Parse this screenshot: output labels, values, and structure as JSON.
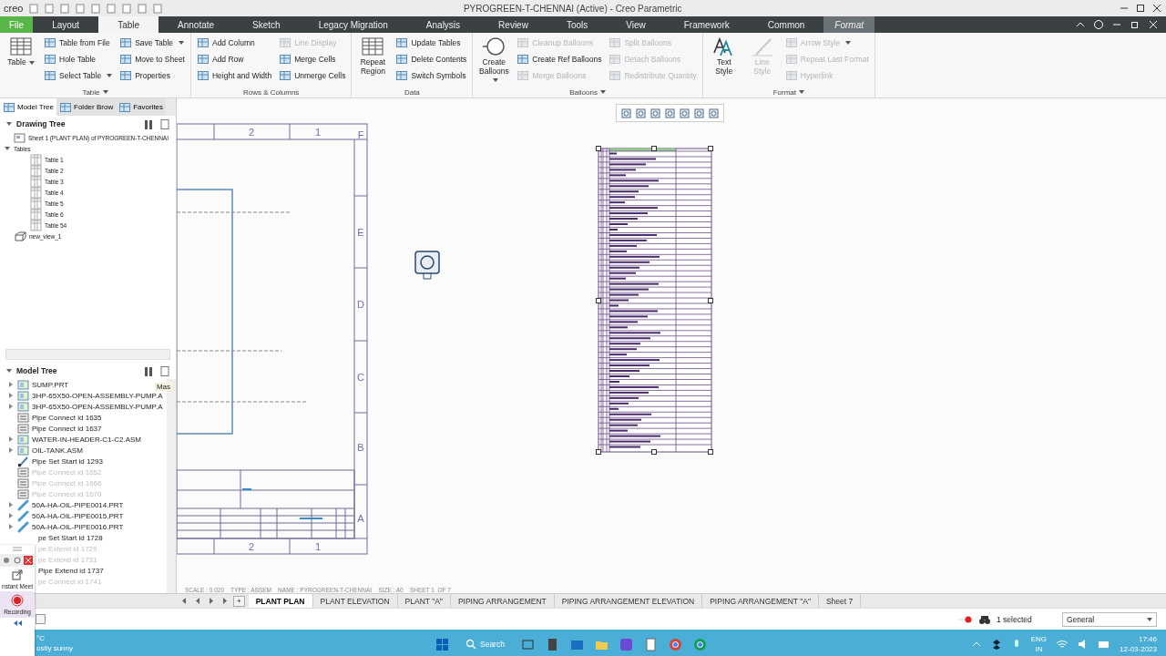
{
  "app_logo": "creo",
  "window": {
    "title": "PYROGREEN-T-CHENNAI (Active) - Creo Parametric"
  },
  "ribbon_tabs": [
    {
      "label": "File",
      "kind": "file",
      "selected": false
    },
    {
      "label": "Layout",
      "kind": "normal",
      "selected": false
    },
    {
      "label": "Table",
      "kind": "normal",
      "selected": true
    },
    {
      "label": "Annotate",
      "kind": "normal",
      "selected": false
    },
    {
      "label": "Sketch",
      "kind": "normal",
      "selected": false
    },
    {
      "label": "Legacy Migration",
      "kind": "normal",
      "selected": false
    },
    {
      "label": "Analysis",
      "kind": "normal",
      "selected": false
    },
    {
      "label": "Review",
      "kind": "normal",
      "selected": false
    },
    {
      "label": "Tools",
      "kind": "normal",
      "selected": false
    },
    {
      "label": "View",
      "kind": "normal",
      "selected": false
    },
    {
      "label": "Framework",
      "kind": "normal",
      "selected": false
    },
    {
      "label": "Common",
      "kind": "normal",
      "selected": false
    },
    {
      "label": "Format",
      "kind": "contextual",
      "selected": false
    }
  ],
  "ribbon_groups": [
    {
      "label": "Table",
      "dropdown": true,
      "large": [
        {
          "label": "Table",
          "kind": "table",
          "dropdown": true,
          "disabled": false
        }
      ],
      "columns": [
        [
          {
            "label": "Table from File",
            "dropdown": false,
            "disabled": false
          },
          {
            "label": "Hole Table",
            "dropdown": false,
            "disabled": false
          },
          {
            "label": "Select Table",
            "dropdown": true,
            "disabled": false
          }
        ],
        [
          {
            "label": "Save Table",
            "dropdown": true,
            "disabled": false
          },
          {
            "label": "Move to Sheet",
            "dropdown": false,
            "disabled": false
          },
          {
            "label": "Properties",
            "dropdown": false,
            "disabled": false
          }
        ]
      ]
    },
    {
      "label": "Rows & Columns",
      "dropdown": false,
      "columns": [
        [
          {
            "label": "Add Column",
            "dropdown": false,
            "disabled": false
          },
          {
            "label": "Add Row",
            "dropdown": false,
            "disabled": false
          },
          {
            "label": "Height and Width",
            "dropdown": false,
            "disabled": false
          }
        ],
        [
          {
            "label": "Line Display",
            "dropdown": false,
            "disabled": true
          },
          {
            "label": "Merge Cells",
            "dropdown": false,
            "disabled": false
          },
          {
            "label": "Unmerge Cells",
            "dropdown": false,
            "disabled": false
          }
        ]
      ]
    },
    {
      "label": "Data",
      "dropdown": false,
      "large": [
        {
          "label": "Repeat Region",
          "kind": "table",
          "dropdown": false,
          "disabled": false
        }
      ],
      "columns": [
        [
          {
            "label": "Update Tables",
            "dropdown": false,
            "disabled": false
          },
          {
            "label": "Delete Contents",
            "dropdown": false,
            "disabled": false
          },
          {
            "label": "Switch Symbols",
            "dropdown": false,
            "disabled": false
          }
        ]
      ]
    },
    {
      "label": "Balloons",
      "dropdown": true,
      "large": [
        {
          "label": "Create Balloons",
          "kind": "balloon",
          "dropdown": true,
          "disabled": false
        }
      ],
      "columns": [
        [
          {
            "label": "Cleanup Balloons",
            "dropdown": false,
            "disabled": true
          },
          {
            "label": "Create Ref Balloons",
            "dropdown": false,
            "disabled": false
          },
          {
            "label": "Merge Balloons",
            "dropdown": false,
            "disabled": true
          }
        ],
        [
          {
            "label": "Split Balloons",
            "dropdown": false,
            "disabled": true
          },
          {
            "label": "Detach Balloons",
            "dropdown": false,
            "disabled": true
          },
          {
            "label": "Redistribute Quantity",
            "dropdown": false,
            "disabled": true
          }
        ]
      ]
    },
    {
      "label": "Format",
      "dropdown": true,
      "large": [
        {
          "label": "Text Style",
          "kind": "text",
          "dropdown": false,
          "disabled": false
        },
        {
          "label": "Line Style",
          "kind": "pen",
          "dropdown": false,
          "disabled": true
        }
      ],
      "columns": [
        [
          {
            "label": "Arrow Style",
            "dropdown": true,
            "disabled": true
          },
          {
            "label": "Repeat Last Format",
            "dropdown": false,
            "disabled": true
          },
          {
            "label": "Hyperlink",
            "dropdown": false,
            "disabled": true
          }
        ]
      ]
    }
  ],
  "panel_tabs": [
    {
      "label": "Model Tree",
      "selected": true
    },
    {
      "label": "Folder Brow",
      "selected": false
    },
    {
      "label": "Favorites",
      "selected": false
    }
  ],
  "drawing_tree": {
    "title": "Drawing Tree",
    "items": [
      {
        "label": "Sheet 1 (PLANT PLAN) of PYROGREEN-T-CHENNAI",
        "kind": "sheet"
      },
      {
        "label": "Tables",
        "kind": "folder",
        "expanded": true,
        "children": [
          {
            "label": "Table 1",
            "kind": "table"
          },
          {
            "label": "Table 2",
            "kind": "table"
          },
          {
            "label": "Table 3",
            "kind": "table"
          },
          {
            "label": "Table 4",
            "kind": "table"
          },
          {
            "label": "Table 5",
            "kind": "table"
          },
          {
            "label": "Table 6",
            "kind": "table"
          },
          {
            "label": "Table 54",
            "kind": "table"
          }
        ]
      },
      {
        "label": "new_view_1",
        "kind": "view"
      }
    ]
  },
  "model_tree": {
    "title": "Model Tree",
    "side_tab": "Mas",
    "items": [
      {
        "label": "SUMP.PRT",
        "kind": "part",
        "expanded": false,
        "disabled": false
      },
      {
        "label": "3HP-65X50-OPEN-ASSEMBLY-PUMP.A",
        "kind": "assembly",
        "expanded": false,
        "disabled": false
      },
      {
        "label": "3HP-65X50-OPEN-ASSEMBLY-PUMP.A",
        "kind": "assembly",
        "expanded": false,
        "disabled": false
      },
      {
        "label": "Pipe Connect id 1635",
        "kind": "connect",
        "disabled": false
      },
      {
        "label": "Pipe Connect id 1637",
        "kind": "connect",
        "disabled": false
      },
      {
        "label": "WATER-IN-HEADER-C1-C2.ASM",
        "kind": "assembly",
        "expanded": false,
        "disabled": false
      },
      {
        "label": "OIL-TANK.ASM",
        "kind": "assembly",
        "expanded": false,
        "disabled": false
      },
      {
        "label": "Pipe Set Start id 1293",
        "kind": "start",
        "disabled": false
      },
      {
        "label": "Pipe Connect id 1652",
        "kind": "connect",
        "disabled": true
      },
      {
        "label": "Pipe Connect id 1666",
        "kind": "connect",
        "disabled": true
      },
      {
        "label": "Pipe Connect id 1670",
        "kind": "connect",
        "disabled": true
      },
      {
        "label": "50A-HA-OIL-PIPE0014.PRT",
        "kind": "pipe",
        "expanded": false,
        "disabled": false
      },
      {
        "label": "50A-HA-OIL-PIPE0015.PRT",
        "kind": "pipe",
        "expanded": false,
        "disabled": false
      },
      {
        "label": "50A-HA-OIL-PIPE0016.PRT",
        "kind": "pipe",
        "expanded": false,
        "disabled": false
      },
      {
        "label": "pe Set Start id 1728",
        "kind": "covered",
        "disabled": false
      },
      {
        "label": "pe Extend id 1729",
        "kind": "covered",
        "disabled": true
      },
      {
        "label": "pe Extend id 1731",
        "kind": "covered",
        "disabled": true
      },
      {
        "label": "Pipe Extend id 1737",
        "kind": "covered",
        "disabled": false
      },
      {
        "label": "pe Connect id 1741",
        "kind": "covered",
        "disabled": true
      }
    ]
  },
  "canvas": {
    "zone_labels": [
      {
        "label": "2",
        "kind": "top"
      },
      {
        "label": "1",
        "kind": "top"
      },
      {
        "label": "F",
        "kind": "side"
      },
      {
        "label": "E",
        "kind": "side"
      },
      {
        "label": "D",
        "kind": "side"
      },
      {
        "label": "C",
        "kind": "side"
      },
      {
        "label": "B",
        "kind": "side"
      },
      {
        "label": "A",
        "kind": "side"
      },
      {
        "label": "2",
        "kind": "bottom"
      },
      {
        "label": "1",
        "kind": "bottom"
      }
    ],
    "sheet_info": "SCALE : 0.020    TYPE : ASSEM    NAME : PYROGREEN-T-CHENNAI    SIZE : A0    SHEET 1  OF 7"
  },
  "sheet_tabs": {
    "add": "+",
    "tabs": [
      {
        "label": "PLANT PLAN",
        "selected": true
      },
      {
        "label": "PLANT ELEVATION",
        "selected": false
      },
      {
        "label": "PLANT \"A\"",
        "selected": false
      },
      {
        "label": "PIPING ARRANGEMENT",
        "selected": false
      },
      {
        "label": "PIPING ARRANGEMENT ELEVATION",
        "selected": false
      },
      {
        "label": "PIPING ARRANGEMENT \"A\"",
        "selected": false
      },
      {
        "label": "Sheet 7",
        "selected": false
      }
    ]
  },
  "status_bar": {
    "selection": "1 selected",
    "filter": "General"
  },
  "meeting_widget": {
    "share_label": "nstant Meet",
    "record_label": "Recording"
  },
  "taskbar": {
    "weather": "°C",
    "weather_text": "ostly sunny",
    "search": "Search",
    "language": "ENG",
    "region": "IN",
    "time": "17:46",
    "date": "12-03-2023"
  }
}
